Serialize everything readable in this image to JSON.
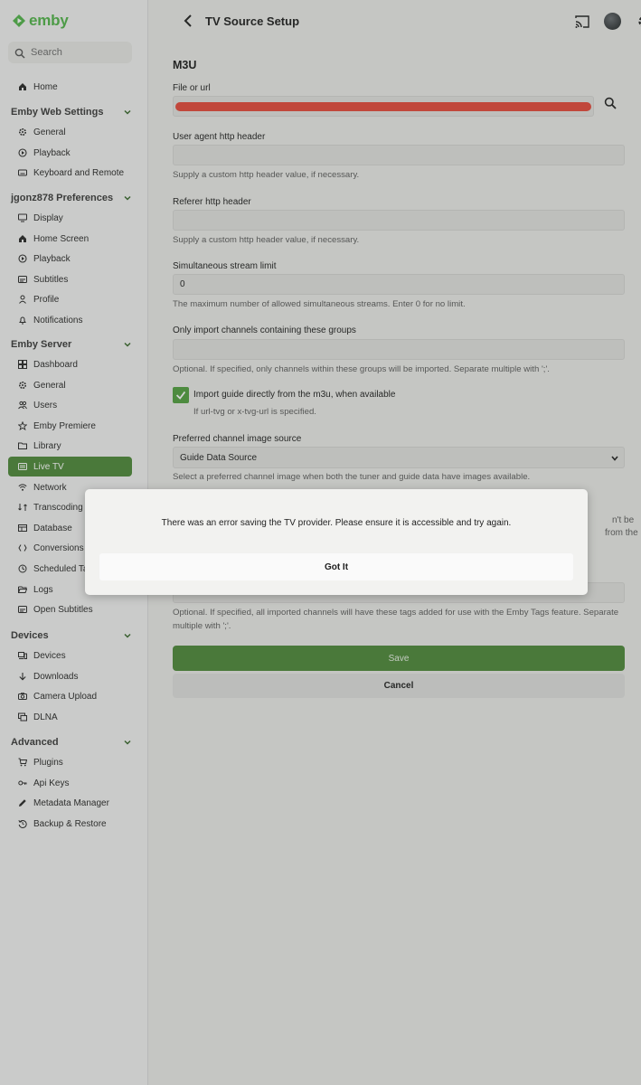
{
  "app": {
    "logo_text": "emby",
    "brand_color": "#52b54b",
    "accent_color": "#4f8a3a"
  },
  "sidebar": {
    "search_placeholder": "Search",
    "home": {
      "label": "Home",
      "icon": "home-icon"
    },
    "sections": [
      {
        "title": "Emby Web Settings",
        "items": [
          {
            "label": "General",
            "icon": "gear-icon"
          },
          {
            "label": "Playback",
            "icon": "play-circle-icon"
          },
          {
            "label": "Keyboard and Remote",
            "icon": "keyboard-icon"
          }
        ]
      },
      {
        "title": "jgonz878 Preferences",
        "items": [
          {
            "label": "Display",
            "icon": "monitor-icon"
          },
          {
            "label": "Home Screen",
            "icon": "home-icon"
          },
          {
            "label": "Playback",
            "icon": "play-circle-icon"
          },
          {
            "label": "Subtitles",
            "icon": "subtitles-icon"
          },
          {
            "label": "Profile",
            "icon": "person-icon"
          },
          {
            "label": "Notifications",
            "icon": "bell-icon"
          }
        ]
      },
      {
        "title": "Emby Server",
        "items": [
          {
            "label": "Dashboard",
            "icon": "dashboard-icon"
          },
          {
            "label": "General",
            "icon": "gear-icon"
          },
          {
            "label": "Users",
            "icon": "users-icon"
          },
          {
            "label": "Emby Premiere",
            "icon": "star-icon"
          },
          {
            "label": "Library",
            "icon": "folder-icon"
          },
          {
            "label": "Live TV",
            "icon": "tv-guide-icon",
            "active": true
          },
          {
            "label": "Network",
            "icon": "wifi-icon"
          },
          {
            "label": "Transcoding",
            "icon": "transcode-icon"
          },
          {
            "label": "Database",
            "icon": "database-icon"
          },
          {
            "label": "Conversions",
            "icon": "conversions-icon"
          },
          {
            "label": "Scheduled Ta",
            "icon": "clock-icon"
          },
          {
            "label": "Logs",
            "icon": "folder-open-icon"
          },
          {
            "label": "Open Subtitles",
            "icon": "subtitles-icon"
          }
        ]
      },
      {
        "title": "Devices",
        "items": [
          {
            "label": "Devices",
            "icon": "devices-icon"
          },
          {
            "label": "Downloads",
            "icon": "download-icon"
          },
          {
            "label": "Camera Upload",
            "icon": "camera-icon"
          },
          {
            "label": "DLNA",
            "icon": "dlna-icon"
          }
        ]
      },
      {
        "title": "Advanced",
        "items": [
          {
            "label": "Plugins",
            "icon": "cart-icon"
          },
          {
            "label": "Api Keys",
            "icon": "key-icon"
          },
          {
            "label": "Metadata Manager",
            "icon": "pencil-icon"
          },
          {
            "label": "Backup & Restore",
            "icon": "restore-icon"
          }
        ]
      }
    ]
  },
  "header": {
    "title": "TV Source Setup"
  },
  "form": {
    "heading": "M3U",
    "file_label": "File or url",
    "file_value": "",
    "user_agent_label": "User agent http header",
    "user_agent_hint": "Supply a custom http header value, if necessary.",
    "referer_label": "Referer http header",
    "referer_hint": "Supply a custom http header value, if necessary.",
    "stream_limit_label": "Simultaneous stream limit",
    "stream_limit_value": "0",
    "stream_limit_hint": "The maximum number of allowed simultaneous streams. Enter 0 for no limit.",
    "groups_label": "Only import channels containing these groups",
    "groups_hint": "Optional. If specified, only channels within these groups will be imported. Separate multiple with ';'.",
    "import_guide_label": "Import guide directly from the m3u, when available",
    "import_guide_checked": true,
    "import_guide_hint": "If url-tvg or x-tvg-url is specified.",
    "image_source_label": "Preferred channel image source",
    "image_source_value": "Guide Data Source",
    "image_source_hint": "Select a preferred channel image when both the tuner and guide data have images available.",
    "partial_right_1": "n't be",
    "partial_right_2": "from the",
    "tags_hint": "Optional. If specified, all imported channels will have these tags added for use with the Emby Tags feature. Separate multiple with ';'.",
    "save_label": "Save",
    "cancel_label": "Cancel"
  },
  "dialog": {
    "message": "There was an error saving the TV provider. Please ensure it is accessible and try again.",
    "button_label": "Got It"
  }
}
